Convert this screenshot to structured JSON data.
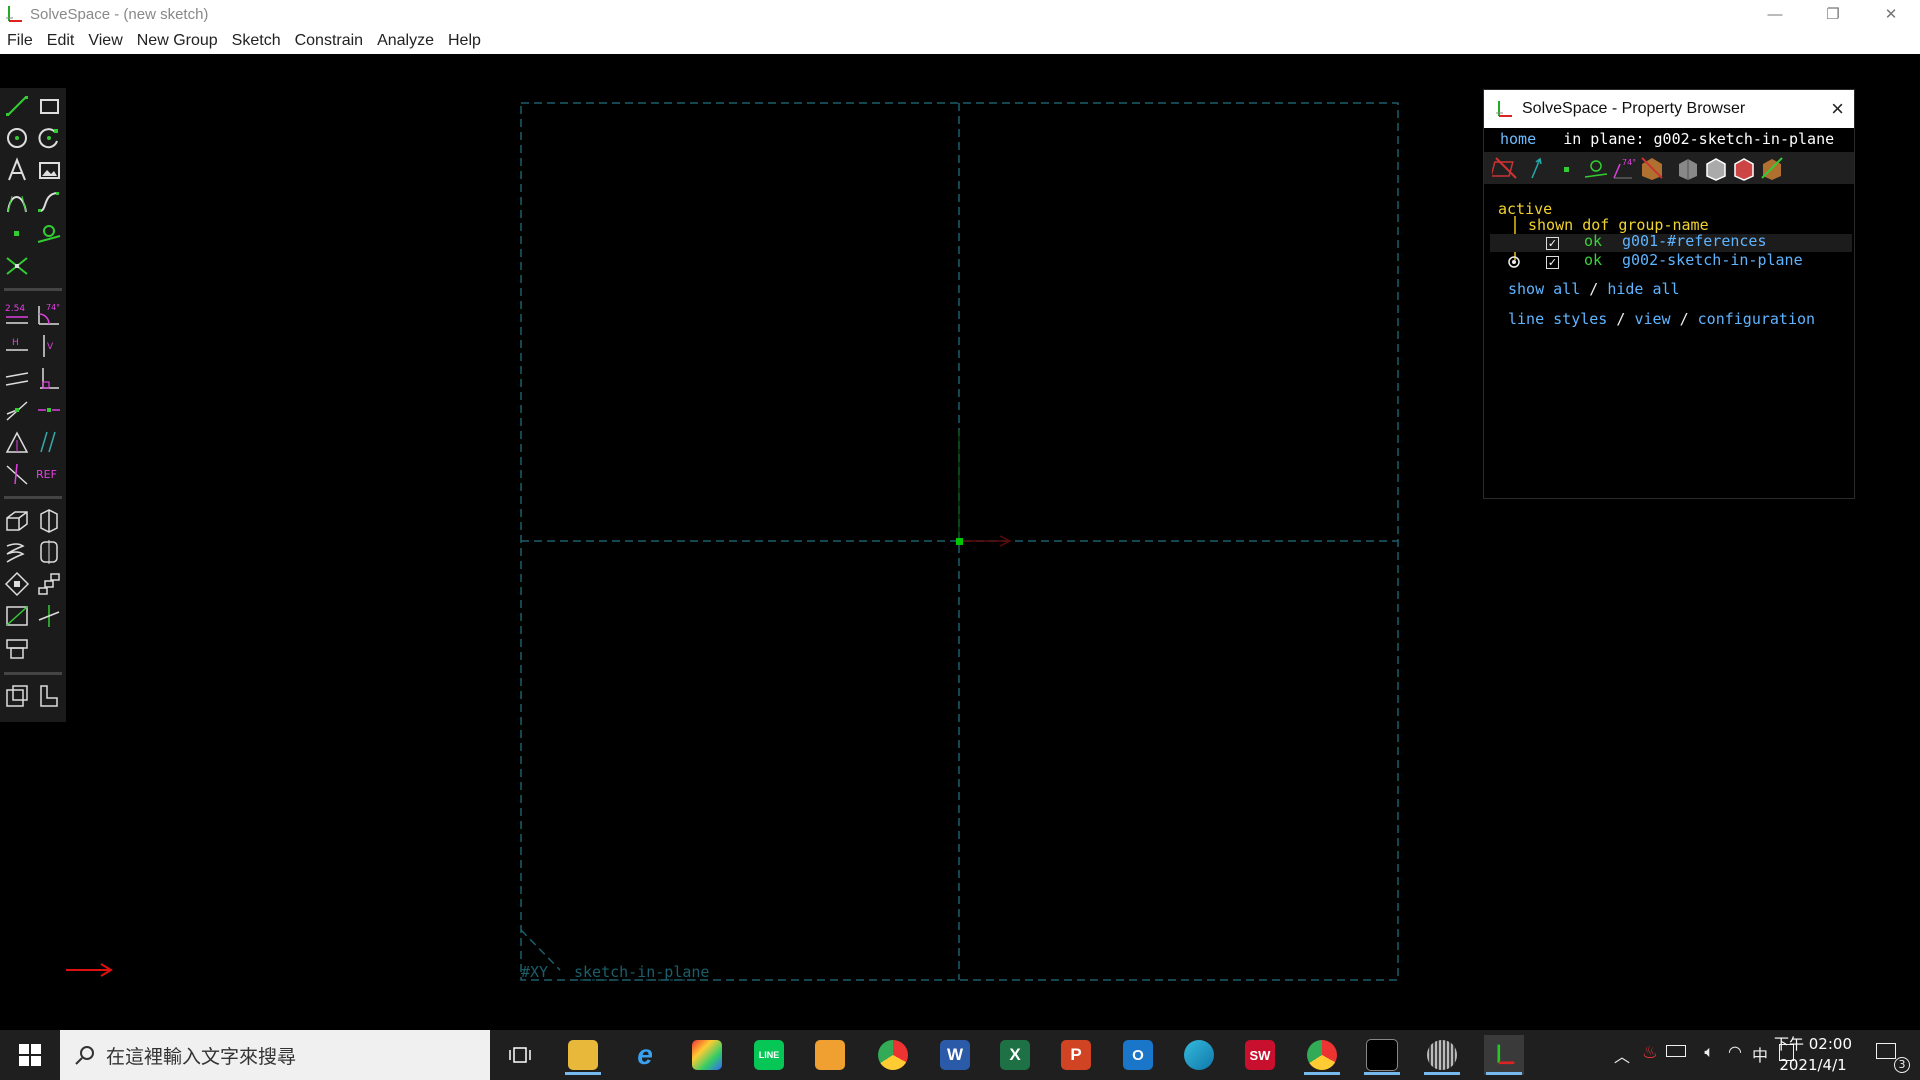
{
  "window": {
    "title": "SolveSpace - (new sketch)",
    "controls": {
      "minimize": "—",
      "maximize": "❐",
      "close": "✕"
    }
  },
  "menu": {
    "items": [
      "File",
      "Edit",
      "View",
      "New Group",
      "Sketch",
      "Constrain",
      "Analyze",
      "Help"
    ]
  },
  "toolbar": {
    "tools": [
      {
        "name": "line-tool-icon"
      },
      {
        "name": "rectangle-tool-icon"
      },
      {
        "name": "circle-tool-icon"
      },
      {
        "name": "arc-tool-icon"
      },
      {
        "name": "text-tool-icon"
      },
      {
        "name": "image-tool-icon"
      },
      {
        "name": "bezier-tool-icon"
      },
      {
        "name": "spline-tool-icon"
      },
      {
        "name": "point-tool-icon"
      },
      {
        "name": "workplane-tool-icon"
      },
      {
        "name": "split-curves-icon"
      },
      {
        "name": "distance-constraint-icon",
        "text": "2.54"
      },
      {
        "name": "angle-constraint-icon",
        "text": "74°"
      },
      {
        "name": "horizontal-constraint-icon",
        "text": "H"
      },
      {
        "name": "vertical-constraint-icon",
        "text": "V"
      },
      {
        "name": "parallel-constraint-icon"
      },
      {
        "name": "perpendicular-constraint-icon"
      },
      {
        "name": "point-on-line-constraint-icon"
      },
      {
        "name": "midpoint-constraint-icon"
      },
      {
        "name": "symmetric-constraint-icon"
      },
      {
        "name": "equal-constraint-icon"
      },
      {
        "name": "tangent-constraint-icon"
      },
      {
        "name": "reference-constraint-icon",
        "text": "REF"
      },
      {
        "name": "extrude-group-icon"
      },
      {
        "name": "lathe-group-icon"
      },
      {
        "name": "helix-group-icon"
      },
      {
        "name": "revolve-group-icon"
      },
      {
        "name": "rotate-group-icon"
      },
      {
        "name": "translate-group-icon"
      },
      {
        "name": "workplane-group-icon"
      },
      {
        "name": "sketch-in-3d-icon"
      },
      {
        "name": "assemble-icon"
      },
      {
        "name": "link-group-icon"
      },
      {
        "name": "sketch-in-plane-icon"
      }
    ]
  },
  "canvas": {
    "plane_label": "#XY",
    "group_label": "sketch-in-plane",
    "colors": {
      "dashed": "#1a5f6b",
      "origin": "#00c800",
      "axis_x": "#e01010",
      "axis_y": "#10c010"
    }
  },
  "property_browser": {
    "title": "SolveSpace - Property Browser",
    "nav": {
      "home": "home",
      "in_plane_label": "in plane:",
      "in_plane_value": "g002-sketch-in-plane"
    },
    "active_label": "active",
    "header": {
      "shown": "shown",
      "dof": "dof",
      "group_name": "group-name"
    },
    "groups": [
      {
        "status": "ok",
        "name": "g001-#references",
        "checked": "✓",
        "active": false
      },
      {
        "status": "ok",
        "name": "g002-sketch-in-plane",
        "checked": "✓",
        "active": true
      }
    ],
    "show_all": "show all",
    "slash": "/",
    "hide_all": "hide all",
    "line_styles": "line styles",
    "view": "view",
    "configuration": "configuration"
  },
  "taskbar": {
    "search_placeholder": "在這裡輸入文字來搜尋",
    "apps": [
      {
        "name": "task-view-icon"
      },
      {
        "name": "file-explorer-icon"
      },
      {
        "name": "internet-explorer-icon"
      },
      {
        "name": "paint-app-icon"
      },
      {
        "name": "line-app-icon",
        "text": "LINE"
      },
      {
        "name": "media-player-icon"
      },
      {
        "name": "chrome-icon"
      },
      {
        "name": "word-icon",
        "text": "W"
      },
      {
        "name": "excel-icon",
        "text": "X"
      },
      {
        "name": "powerpoint-icon",
        "text": "P"
      },
      {
        "name": "outlook-icon",
        "text": "O"
      },
      {
        "name": "edge-icon"
      },
      {
        "name": "solidworks-icon",
        "text": "SW"
      },
      {
        "name": "chrome-icon-2"
      },
      {
        "name": "terminal-icon"
      },
      {
        "name": "globe-app-icon"
      },
      {
        "name": "solvespace-taskbar-icon"
      }
    ],
    "ime": "中",
    "time": "下午 02:00",
    "date": "2021/4/1",
    "notification_count": "3"
  }
}
